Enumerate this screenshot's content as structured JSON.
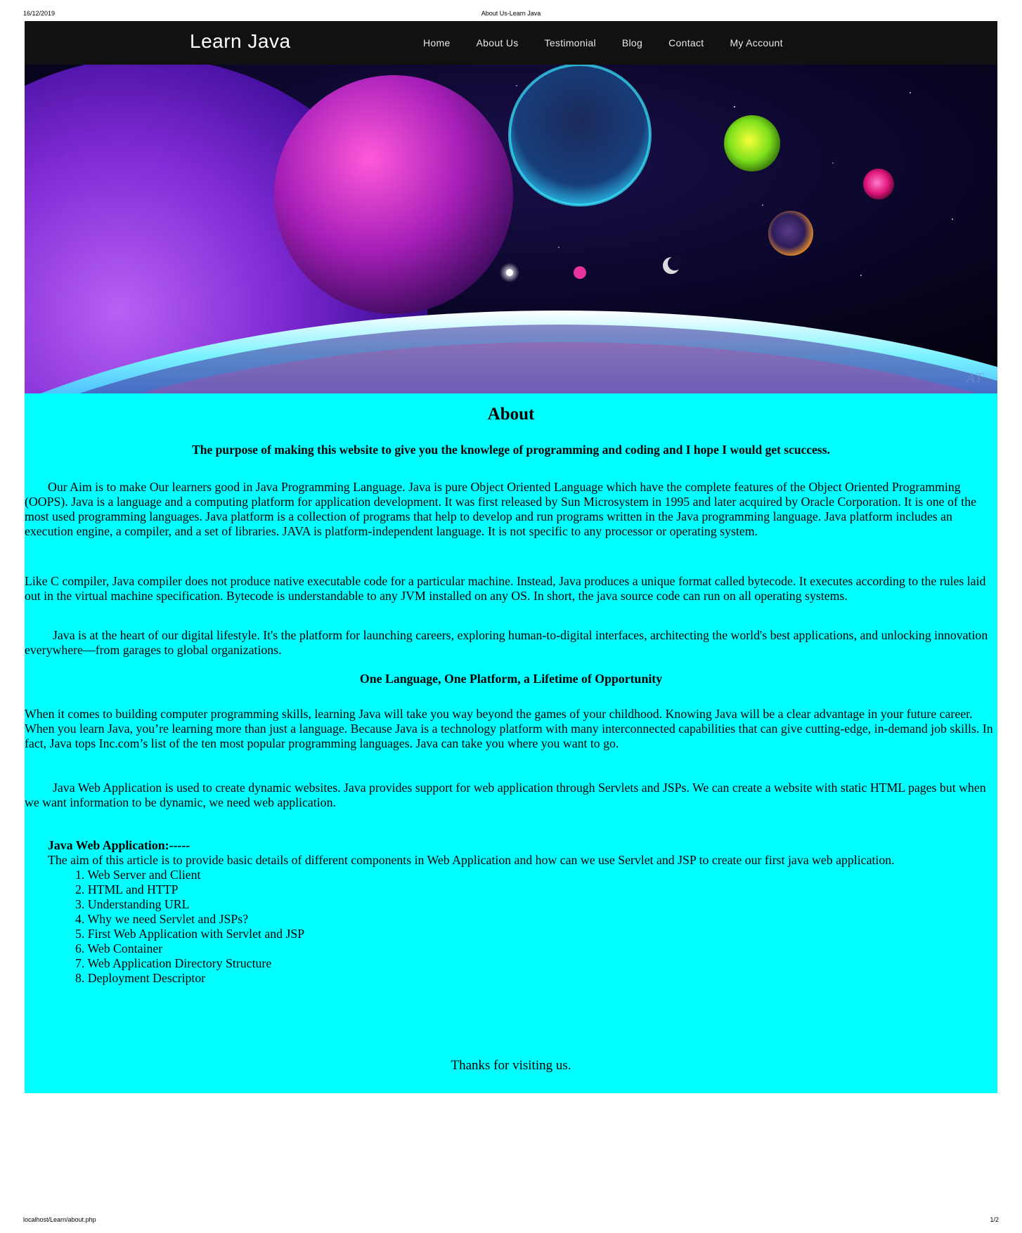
{
  "print": {
    "date": "16/12/2019",
    "title": "About Us-Learn Java",
    "url": "localhost/Learn/about.php",
    "page": "1/2"
  },
  "brand": "Learn Java",
  "nav": [
    {
      "label": "Home"
    },
    {
      "label": "About Us"
    },
    {
      "label": "Testimonial"
    },
    {
      "label": "Blog"
    },
    {
      "label": "Contact"
    },
    {
      "label": "My Account"
    }
  ],
  "hero": {
    "signature": "AT"
  },
  "content": {
    "heading": "About",
    "purpose": "The purpose of making this website to give you the knowlege of programming and coding and I hope I would get scuccess.",
    "para1": "Our Aim is to make Our learners good in Java Programming Language. Java is pure Object Oriented Language which have the complete features of the Object Oriented Programming (OOPS). Java is a language and a computing platform for application development. It was first released by Sun Microsystem in 1995 and later acquired by Oracle Corporation. It is one of the most used programming languages. Java platform is a collection of programs that help to develop and run programs written in the Java programming language. Java platform includes an execution engine, a compiler, and a set of libraries. JAVA is platform-independent language. It is not specific to any processor or operating system.",
    "para2": "Like C compiler, Java compiler does not produce native executable code for a particular machine. Instead, Java produces a unique format called bytecode. It executes according to the rules laid out in the virtual machine specification. Bytecode is understandable to any JVM installed on any OS. In short, the java source code can run on all operating systems.",
    "para3": "Java is at the heart of our digital lifestyle. It's the platform for launching careers, exploring human-to-digital interfaces, architecting the world's best applications, and unlocking innovation everywhere—from garages to global organizations.",
    "subheading": "One Language, One Platform, a Lifetime of Opportunity",
    "para4": "When it comes to building computer programming skills, learning Java will take you way beyond the games of your childhood. Knowing Java will be a clear advantage in your future career. When you learn Java, you’re learning more than just a language. Because Java is a technology platform with many interconnected capabilities that can give cutting-edge, in-demand job skills. In fact, Java tops Inc.com’s list of the ten most popular programming languages. Java can take you where you want to go.",
    "para5": "Java Web Application is used to create dynamic websites. Java provides support for web application through Servlets and JSPs. We can create a website with static HTML pages but when we want information to be dynamic, we need web application.",
    "webapp_heading": "Java Web Application:-----",
    "webapp_intro": "The aim of this article is to provide basic details of different components in Web Application and how can we use Servlet and JSP to create our first java web application.",
    "steps": [
      "1. Web Server and Client",
      "2. HTML and HTTP",
      "3. Understanding URL",
      "4. Why we need Servlet and JSPs?",
      "5. First Web Application with Servlet and JSP",
      "6. Web Container",
      "7. Web Application Directory Structure",
      "8. Deployment Descriptor"
    ],
    "thanks": "Thanks for visiting us."
  },
  "colors": {
    "navbar": "#111111",
    "content_bg": "#00ffff"
  }
}
